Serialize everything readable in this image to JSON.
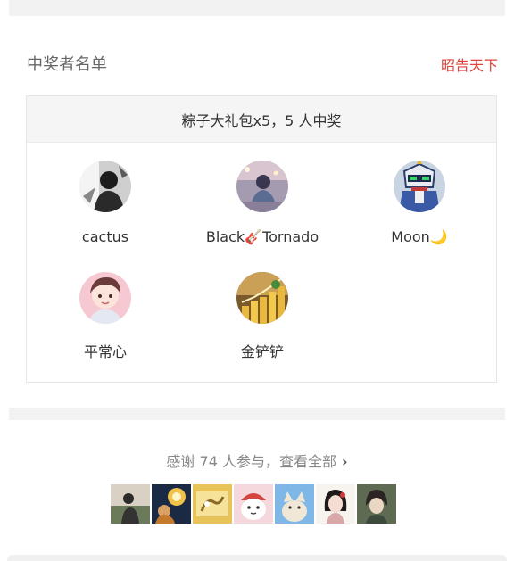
{
  "winners_section": {
    "title": "中奖者名单",
    "announce_label": "昭告天下",
    "prize_line": "粽子大礼包x5，5 人中奖",
    "winners": [
      {
        "name": "cactus"
      },
      {
        "name": "Black🎸Tornado"
      },
      {
        "name": "Moon🌙"
      },
      {
        "name": "平常心"
      },
      {
        "name": "金铲铲"
      }
    ]
  },
  "participants_section": {
    "thanks_text": "感谢 74 人参与，查看全部",
    "chevron": "›"
  },
  "colors": {
    "accent_red": "#e0413a",
    "band_gray": "#f2f2f2"
  }
}
